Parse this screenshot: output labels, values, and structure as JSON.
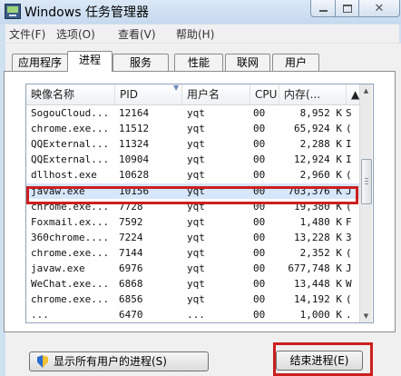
{
  "window": {
    "title": "Windows 任务管理器",
    "close_symbol": "✕"
  },
  "menu": [
    {
      "label": "文件(F)"
    },
    {
      "label": "选项(O)"
    },
    {
      "label": "查看(V)"
    },
    {
      "label": "帮助(H)"
    }
  ],
  "tabs": [
    {
      "label": "应用程序"
    },
    {
      "label": "进程",
      "active": true
    },
    {
      "label": "服务"
    },
    {
      "label": "性能"
    },
    {
      "label": "联网"
    },
    {
      "label": "用户"
    }
  ],
  "columns": [
    "映像名称",
    "PID",
    "用户名",
    "CPU",
    "内存(..."
  ],
  "rows": [
    {
      "name": "SogouCloud...",
      "pid": "12164",
      "user": "yqt",
      "cpu": "00",
      "mem": "8,952 K",
      "tail": "S"
    },
    {
      "name": "chrome.exe...",
      "pid": "11512",
      "user": "yqt",
      "cpu": "00",
      "mem": "65,924 K",
      "tail": "("
    },
    {
      "name": "QQExternal...",
      "pid": "11324",
      "user": "yqt",
      "cpu": "00",
      "mem": "2,288 K",
      "tail": "I"
    },
    {
      "name": "QQExternal...",
      "pid": "10904",
      "user": "yqt",
      "cpu": "00",
      "mem": "12,924 K",
      "tail": "I"
    },
    {
      "name": "dllhost.exe",
      "pid": "10628",
      "user": "yqt",
      "cpu": "00",
      "mem": "2,960 K",
      "tail": "("
    },
    {
      "name": "javaw.exe",
      "pid": "10156",
      "user": "yqt",
      "cpu": "00",
      "mem": "703,376 K",
      "tail": "J",
      "selected": true
    },
    {
      "name": "chrome.exe...",
      "pid": "7728",
      "user": "yqt",
      "cpu": "00",
      "mem": "19,380 K",
      "tail": "("
    },
    {
      "name": "Foxmail.ex...",
      "pid": "7592",
      "user": "yqt",
      "cpu": "00",
      "mem": "1,480 K",
      "tail": "F"
    },
    {
      "name": "360chrome....",
      "pid": "7224",
      "user": "yqt",
      "cpu": "00",
      "mem": "13,228 K",
      "tail": "3"
    },
    {
      "name": "chrome.exe...",
      "pid": "7144",
      "user": "yqt",
      "cpu": "00",
      "mem": "2,352 K",
      "tail": "("
    },
    {
      "name": "javaw.exe",
      "pid": "6976",
      "user": "yqt",
      "cpu": "00",
      "mem": "677,748 K",
      "tail": "J"
    },
    {
      "name": "WeChat.exe...",
      "pid": "6868",
      "user": "yqt",
      "cpu": "00",
      "mem": "13,448 K",
      "tail": "W"
    },
    {
      "name": "chrome.exe...",
      "pid": "6856",
      "user": "yqt",
      "cpu": "00",
      "mem": "14,192 K",
      "tail": "("
    },
    {
      "name": "...",
      "pid": "6470",
      "user": "...",
      "cpu": "00",
      "mem": "1,000 K",
      "tail": "."
    }
  ],
  "buttons": {
    "show_all": "显示所有用户的进程(S)",
    "end_process": "结束进程(E)"
  },
  "colors": {
    "annotation": "#cc1f1f",
    "selection": "#d6e6fb"
  }
}
